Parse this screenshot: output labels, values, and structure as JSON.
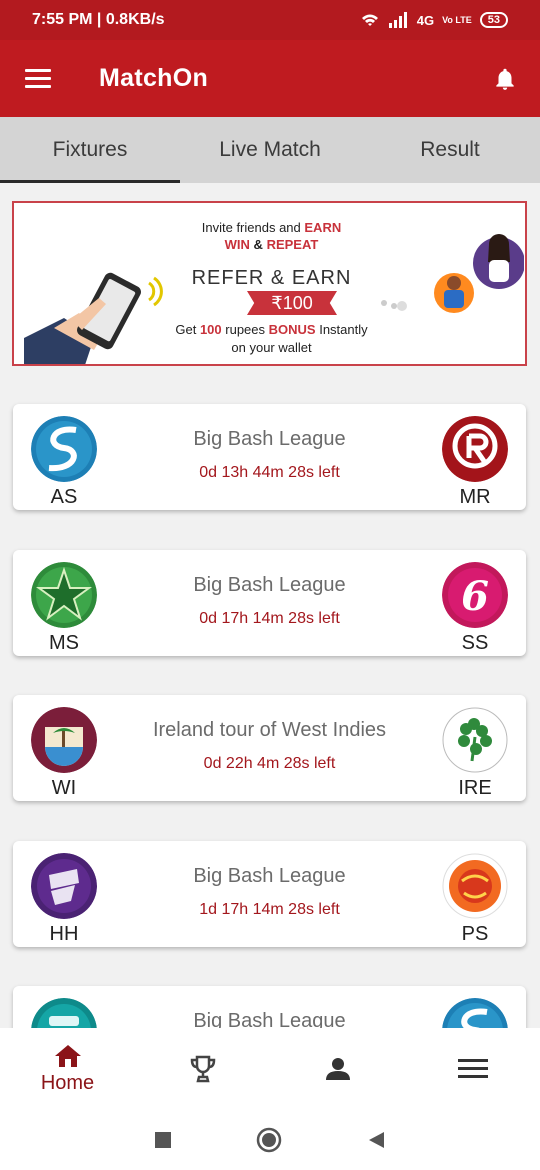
{
  "status_bar": {
    "time_speed": "7:55 PM | 0.8KB/s",
    "network": "4G",
    "carrier": "Vo LTE",
    "battery": "53"
  },
  "app": {
    "title": "MatchOn",
    "brand_color": "#bf1b20"
  },
  "tabs": [
    {
      "label": "Fixtures",
      "active": true
    },
    {
      "label": "Live Match",
      "active": false
    },
    {
      "label": "Result",
      "active": false
    }
  ],
  "banner": {
    "invite_prefix": "Invite friends and ",
    "invite_earn": "EARN",
    "win": "WIN",
    "amp": " & ",
    "repeat": "REPEAT",
    "refer": "REFER & EARN",
    "amount": "₹100",
    "bonus_prefix": "Get ",
    "bonus_amount": "100",
    "bonus_mid": " rupees ",
    "bonus_word": "BONUS",
    "bonus_suffix": " Instantly",
    "wallet": "on your wallet"
  },
  "fixtures": [
    {
      "home": "AS",
      "away": "MR",
      "league": "Big Bash League",
      "countdown": "0d 13h 44m 28s left"
    },
    {
      "home": "MS",
      "away": "SS",
      "league": "Big Bash League",
      "countdown": "0d 17h 14m 28s left"
    },
    {
      "home": "WI",
      "away": "IRE",
      "league": "Ireland tour of West Indies",
      "countdown": "0d 22h 4m 28s left"
    },
    {
      "home": "HH",
      "away": "PS",
      "league": "Big Bash League",
      "countdown": "1d 17h 14m 28s left"
    },
    {
      "home": "",
      "away": "",
      "league": "Big Bash League",
      "countdown": ""
    }
  ],
  "bottom_nav": {
    "home_label": "Home"
  }
}
